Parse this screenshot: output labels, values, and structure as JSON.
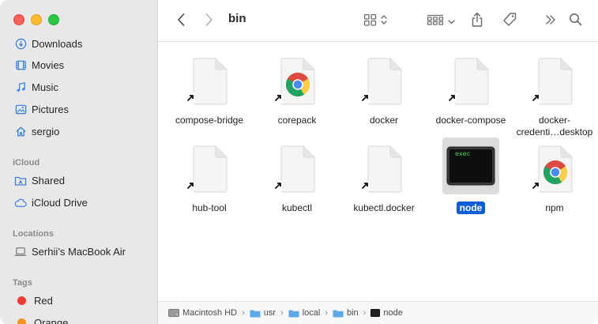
{
  "sidebar": {
    "favorites": [
      {
        "label": "Downloads",
        "icon": "downloads-icon"
      },
      {
        "label": "Movies",
        "icon": "movies-icon"
      },
      {
        "label": "Music",
        "icon": "music-icon"
      },
      {
        "label": "Pictures",
        "icon": "pictures-icon"
      },
      {
        "label": "sergio",
        "icon": "home-icon"
      }
    ],
    "icloud_heading": "iCloud",
    "icloud": [
      {
        "label": "Shared",
        "icon": "shared-folder-icon"
      },
      {
        "label": "iCloud Drive",
        "icon": "icloud-icon"
      }
    ],
    "locations_heading": "Locations",
    "locations": [
      {
        "label": "Serhii’s MacBook Air",
        "icon": "laptop-icon"
      }
    ],
    "tags_heading": "Tags",
    "tags": [
      {
        "label": "Red",
        "color": "#f23b30"
      },
      {
        "label": "Orange",
        "color": "#f5931e"
      }
    ]
  },
  "toolbar": {
    "title": "bin"
  },
  "files": [
    {
      "label": "compose-bridge",
      "kind": "alias-doc"
    },
    {
      "label": "corepack",
      "kind": "alias-chrome"
    },
    {
      "label": "docker",
      "kind": "alias-doc"
    },
    {
      "label": "docker-compose",
      "kind": "alias-doc"
    },
    {
      "label_line1": "docker-",
      "label_line2": "credenti…desktop",
      "kind": "alias-doc"
    },
    {
      "label": "hub-tool",
      "kind": "alias-doc"
    },
    {
      "label": "kubectl",
      "kind": "alias-doc"
    },
    {
      "label": "kubectl.docker",
      "kind": "alias-doc"
    },
    {
      "label": "node",
      "kind": "exec",
      "exec_text": "exec",
      "selected": true
    },
    {
      "label": "npm",
      "kind": "alias-chrome"
    }
  ],
  "pathbar": {
    "crumbs": [
      "Macintosh HD",
      "usr",
      "local",
      "bin",
      "node"
    ]
  },
  "colors": {
    "selection": "#0a5fd8",
    "folder": "#5aa8e8"
  }
}
